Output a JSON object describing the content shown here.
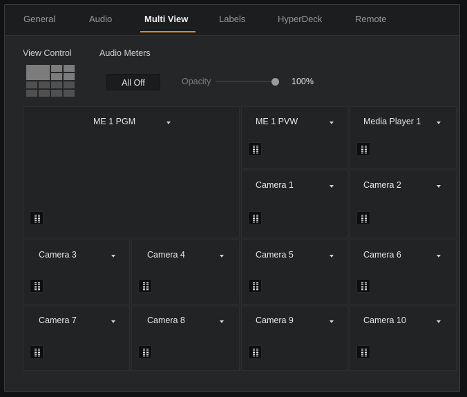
{
  "tabs": [
    {
      "label": "General"
    },
    {
      "label": "Audio"
    },
    {
      "label": "Multi View"
    },
    {
      "label": "Labels"
    },
    {
      "label": "HyperDeck"
    },
    {
      "label": "Remote"
    }
  ],
  "active_tab": "Multi View",
  "sub_tabs": [
    "View Control",
    "Audio Meters"
  ],
  "audio_meters": {
    "all_off_label": "All Off",
    "opacity_label": "Opacity",
    "opacity_value": "100%"
  },
  "windows": [
    {
      "source": "ME 1 PGM"
    },
    {
      "source": "ME 1 PVW"
    },
    {
      "source": "Media Player 1"
    },
    {
      "source": "Camera 1"
    },
    {
      "source": "Camera 2"
    },
    {
      "source": "Camera 3"
    },
    {
      "source": "Camera 4"
    },
    {
      "source": "Camera 5"
    },
    {
      "source": "Camera 6"
    },
    {
      "source": "Camera 7"
    },
    {
      "source": "Camera 8"
    },
    {
      "source": "Camera 9"
    },
    {
      "source": "Camera 10"
    }
  ],
  "colors": {
    "accent": "#e08a1e",
    "background": "#252627",
    "text": "#e6e6e6"
  }
}
